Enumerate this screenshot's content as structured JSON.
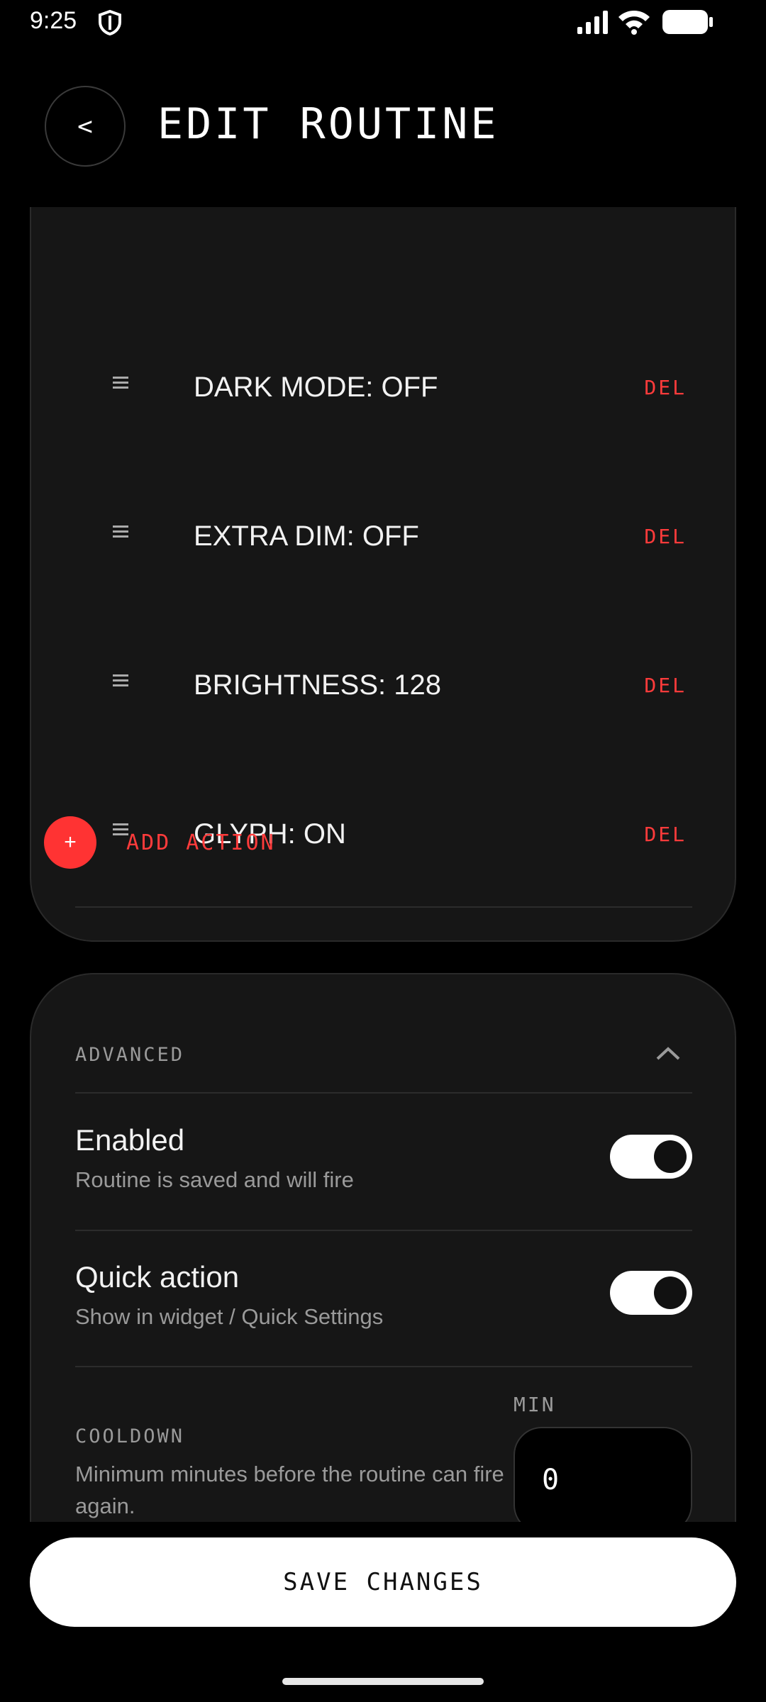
{
  "status_bar": {
    "time": "9:25"
  },
  "header": {
    "back_label": "<",
    "title": "EDIT ROUTINE"
  },
  "actions": {
    "items": [
      {
        "label": "DARK MODE: OFF",
        "delete_label": "DEL"
      },
      {
        "label": "EXTRA DIM: OFF",
        "delete_label": "DEL"
      },
      {
        "label": "BRIGHTNESS: 128",
        "delete_label": "DEL"
      },
      {
        "label": "GLYPH: ON",
        "delete_label": "DEL"
      }
    ],
    "add_label": "ADD ACTION",
    "add_symbol": "+"
  },
  "advanced": {
    "title": "ADVANCED",
    "enabled": {
      "title": "Enabled",
      "description": "Routine is saved and will fire",
      "on": true
    },
    "quick_action": {
      "title": "Quick action",
      "description": "Show in widget / Quick Settings",
      "on": true
    },
    "cooldown": {
      "label": "COOLDOWN",
      "description": "Minimum minutes before the routine can fire again.",
      "unit_label": "MIN",
      "value": "0"
    }
  },
  "footer": {
    "save_label": "SAVE CHANGES"
  },
  "colors": {
    "accent": "#ff3b3b",
    "background": "#000000",
    "card": "#161616"
  }
}
